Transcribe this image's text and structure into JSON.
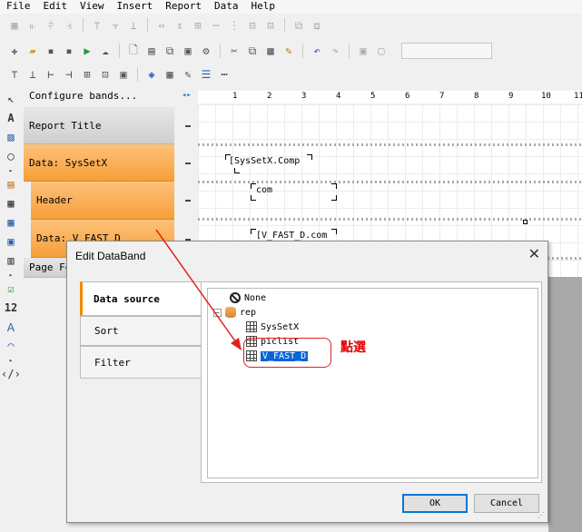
{
  "menu": [
    "File",
    "Edit",
    "View",
    "Insert",
    "Report",
    "Data",
    "Help"
  ],
  "bands_panel": {
    "configure_label": "Configure bands...",
    "report_title": "Report Title",
    "data_sys": "Data: SysSetX",
    "header": "Header",
    "data_vfast": "Data: V_FAST_D",
    "page_footer": "Page Fo"
  },
  "ruler": {
    "numbers": [
      "1",
      "2",
      "3",
      "4",
      "5",
      "6",
      "7",
      "8",
      "9",
      "10",
      "11"
    ]
  },
  "canvas": {
    "field_sys": "[SysSetX.Comp",
    "field_com": "com",
    "field_vfast": "[V_FAST_D.com"
  },
  "dialog": {
    "title": "Edit DataBand",
    "close": "✕",
    "tabs": [
      "Data source",
      "Sort",
      "Filter"
    ],
    "tree": {
      "none": "None",
      "rep": "rep",
      "items": [
        "SysSetX",
        "piclist",
        "V_FAST_D"
      ]
    },
    "ok": "OK",
    "cancel": "Cancel"
  },
  "annotation": {
    "text": "點選",
    "color": "#e00000"
  },
  "colors": {
    "band_orange": "#f79f39",
    "selection": "#0a64d8",
    "tab_accent": "#f08a00"
  }
}
